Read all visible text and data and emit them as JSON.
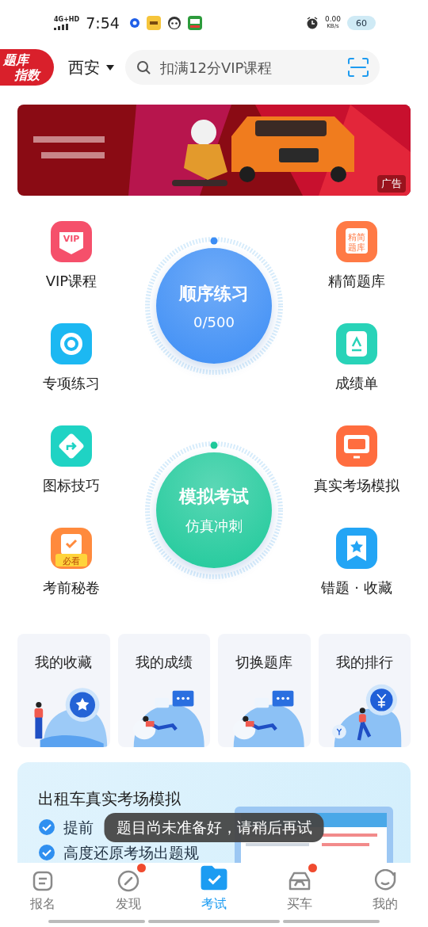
{
  "status_bar": {
    "network": "4G+HD",
    "time": "7:54",
    "speed": "0.00",
    "speed_unit": "KB/s",
    "battery": "60"
  },
  "header": {
    "logo_lines": [
      "题库",
      "指数"
    ],
    "city": "西安",
    "search": {
      "placeholder": "扣满12分VIP课程"
    }
  },
  "banner": {
    "kind": "picture",
    "ad_label": "广告"
  },
  "features": [
    {
      "label": "VIP课程",
      "kind": "vip",
      "icon_text": "VIP",
      "color": "#f5506b"
    },
    {
      "label": "精简题库",
      "kind": "book",
      "icon_text": "精简题库",
      "color": "#ff7a45"
    },
    {
      "label": "专项练习",
      "kind": "target",
      "color": "#1cb8f2"
    },
    {
      "label": "成绩单",
      "kind": "doc",
      "color": "#28d3b8"
    },
    {
      "label": "图标技巧",
      "kind": "sign",
      "color": "#1fd3c4"
    },
    {
      "label": "真实考场模拟",
      "kind": "monitor",
      "color": "#ff6d3f"
    },
    {
      "label": "考前秘卷",
      "kind": "note",
      "icon_text": "必看",
      "color": "#ff8a3d"
    },
    {
      "label": "错题 · 收藏",
      "kind": "star",
      "color": "#23a5f5"
    }
  ],
  "dials": [
    {
      "title": "顺序练习",
      "subtitle": "0/500",
      "color": "#3c8df5"
    },
    {
      "title": "模拟考试",
      "subtitle": "仿真冲刺",
      "color": "#1ec99a"
    }
  ],
  "cards": [
    {
      "title": "我的收藏",
      "kind": "star"
    },
    {
      "title": "我的成绩",
      "kind": "chat"
    },
    {
      "title": "切换题库",
      "kind": "chat"
    },
    {
      "title": "我的排行",
      "kind": "coin"
    }
  ],
  "promo": {
    "title": "出租车真实考场模拟",
    "bullets": [
      "提前",
      "高度还原考场出题规"
    ]
  },
  "toast": "题目尚未准备好，请稍后再试",
  "tabs": [
    {
      "label": "报名",
      "kind": "form",
      "selected": false,
      "badge": false
    },
    {
      "label": "发现",
      "kind": "compass",
      "selected": false,
      "badge": true
    },
    {
      "label": "考试",
      "kind": "folder",
      "selected": true,
      "badge": false
    },
    {
      "label": "买车",
      "kind": "car",
      "selected": false,
      "badge": true
    },
    {
      "label": "我的",
      "kind": "smile",
      "selected": false,
      "badge": false
    }
  ]
}
